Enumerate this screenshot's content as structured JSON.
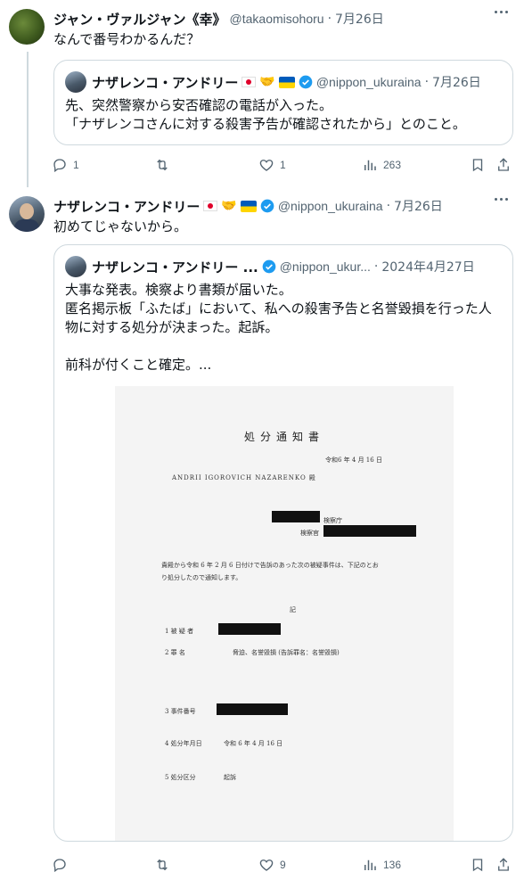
{
  "tweet1": {
    "author_name": "ジャン・ヴァルジャン《幸》",
    "handle": "@takaomisohoru",
    "date": "7月26日",
    "text": "なんで番号わかるんだ？",
    "quote": {
      "author_name": "ナザレンコ・アンドリー",
      "handle": "@nippon_ukuraina",
      "date": "7月26日",
      "text": "先、突然警察から安否確認の電話が入った。\n「ナザレンコさんに対する殺害予告が確認されたから」とのこと。"
    },
    "stats": {
      "replies": "1",
      "retweets": "",
      "likes": "1",
      "views": "263"
    }
  },
  "tweet2": {
    "author_name": "ナザレンコ・アンドリー",
    "handle": "@nippon_ukuraina",
    "date": "7月26日",
    "text": "初めてじゃないから。",
    "quote": {
      "author_name": "ナザレンコ・アンドリー ...",
      "handle": "@nippon_ukur...",
      "date": "2024年4月27日",
      "text": "大事な発表。検察より書類が届いた。\n匿名掲示板「ふたば」において、私への殺害予告と名誉毀損を行った人\n物に対する処分が決まった。起訴。\n\n前科が付くこと確定。..."
    },
    "document": {
      "title": "処分通知書",
      "date_line": "令和6 年 4 月 16 日",
      "addressee": "ANDRII IGOROVICH NAZARENKO 殿",
      "office": "検察庁",
      "officer": "検察官",
      "body": "貴殿から令和 6 年 2 月 6 日付けで告訴のあった次の被疑事件は、下記のとお",
      "body2": "り処分したので通知します。",
      "ki": "記",
      "item1": "1   被 疑 者",
      "item2": "2   罪       名",
      "item2_value": "脅迫、名誉毀損 (告訴罪名：名誉毀損)",
      "item3": "3   事件番号",
      "item4": "4   処分年月日",
      "item4_value": "令和 6 年  4 月 16 日",
      "item5": "5   処分区分",
      "item5_value": "起訴"
    },
    "stats": {
      "replies": "",
      "retweets": "",
      "likes": "9",
      "views": "136"
    }
  },
  "colors": {
    "secondary_text": "#536471",
    "border": "#cfd9de",
    "verified": "#1d9bf0"
  }
}
